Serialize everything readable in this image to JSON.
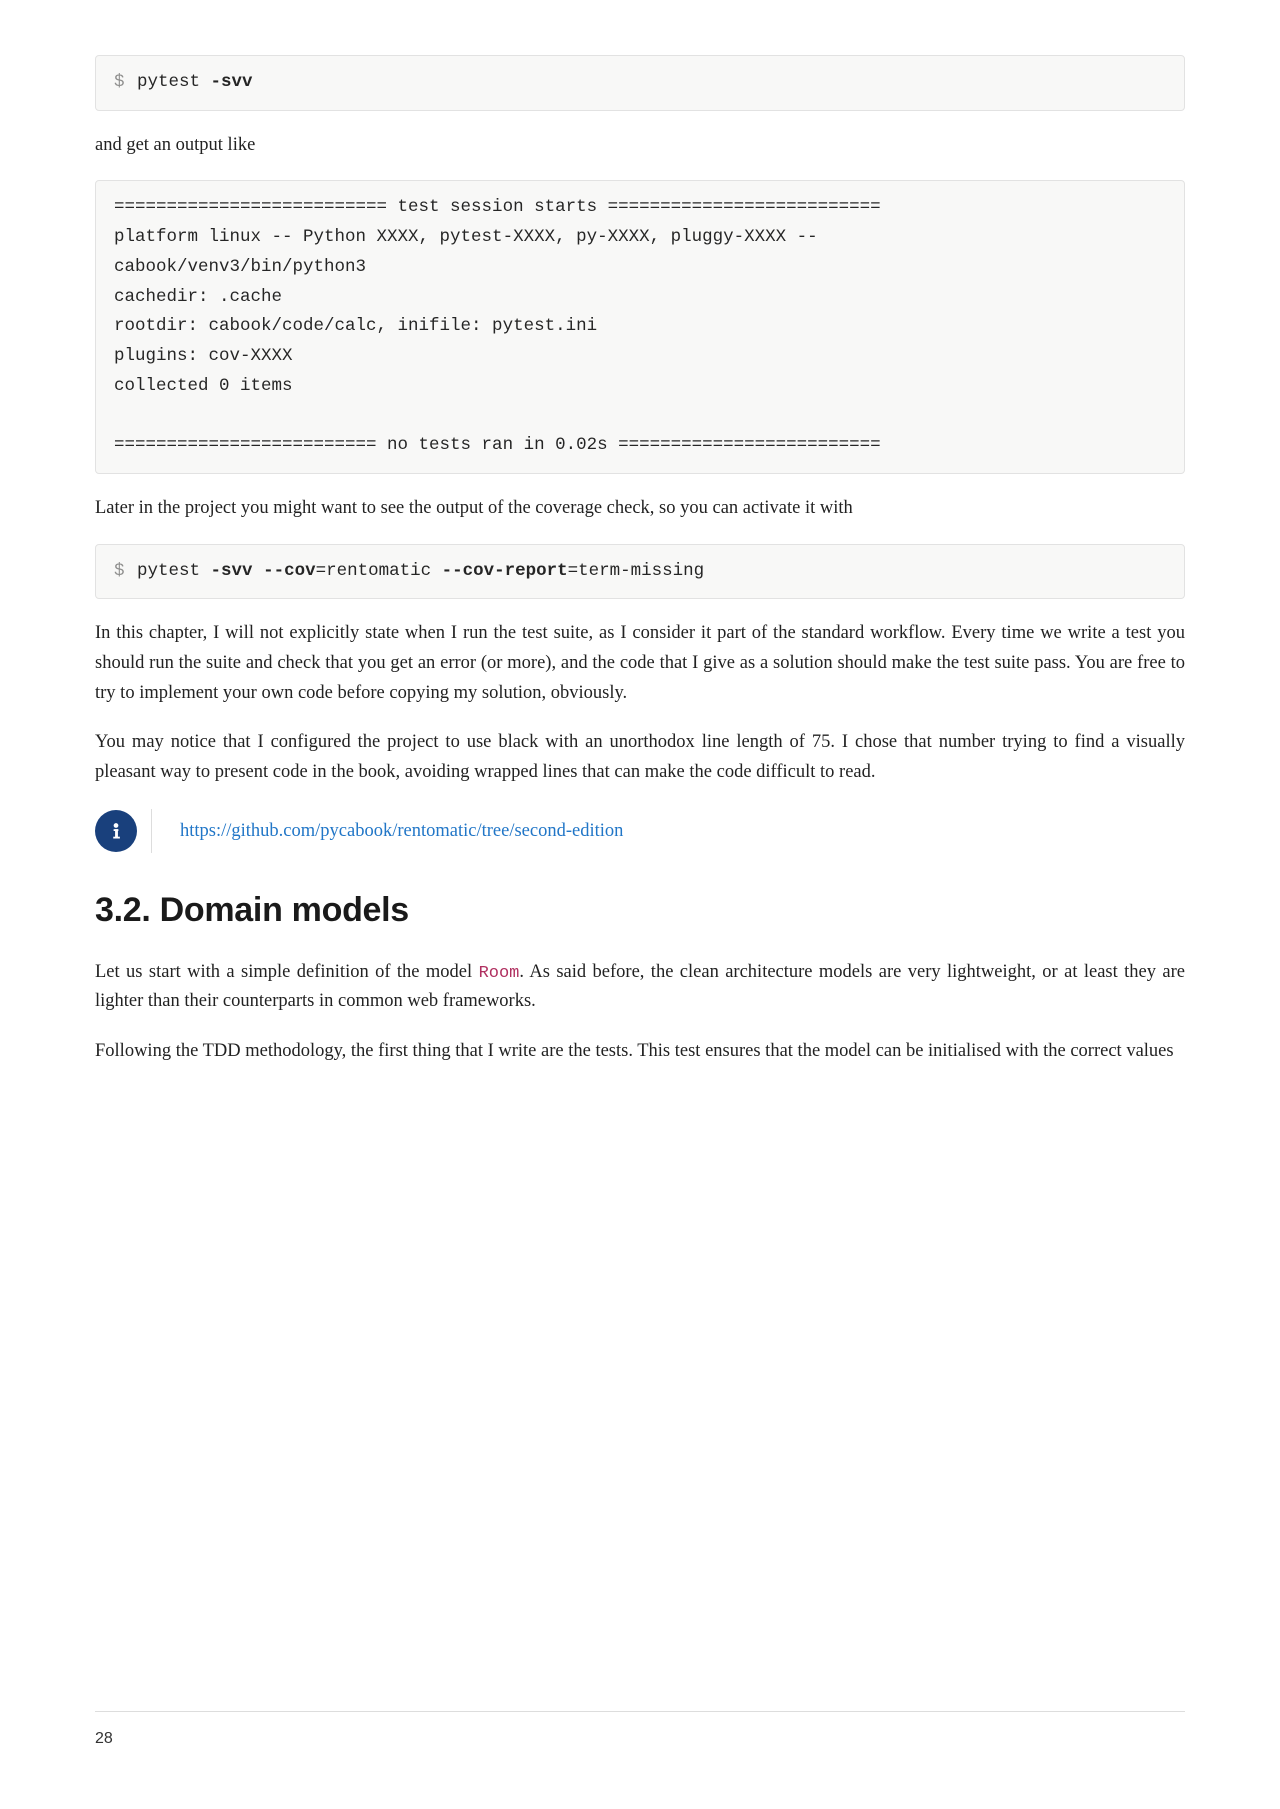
{
  "code1": {
    "prompt": "$",
    "cmd": " pytest ",
    "flag": "-svv"
  },
  "para1": "and get an output like",
  "code2": "========================== test session starts ==========================\nplatform linux -- Python XXXX, pytest-XXXX, py-XXXX, pluggy-XXXX --\ncabook/venv3/bin/python3\ncachedir: .cache\nrootdir: cabook/code/calc, inifile: pytest.ini\nplugins: cov-XXXX\ncollected 0 items\n\n========================= no tests ran in 0.02s =========================",
  "para2": "Later in the project you might want to see the output of the coverage check, so you can activate it with",
  "code3": {
    "prompt": "$",
    "cmd1": " pytest ",
    "flag1": "-svv",
    "sp1": " ",
    "flag2": "--cov",
    "val1": "=rentomatic ",
    "flag3": "--cov-report",
    "val2": "=term-missing"
  },
  "para3": "In this chapter, I will not explicitly state when I run the test suite, as I consider it part of the standard workflow. Every time we write a test you should run the suite and check that you get an error (or more), and the code that I give as a solution should make the test suite pass. You are free to try to implement your own code before copying my solution, obviously.",
  "para4": "You may notice that I configured the project to use black with an unorthodox line length of 75. I chose that number trying to find a visually pleasant way to present code in the book, avoiding wrapped lines that can make the code difficult to read.",
  "info_link": "https://github.com/pycabook/rentomatic/tree/second-edition",
  "section_heading": "3.2. Domain models",
  "para5_pre": "Let us start with a simple definition of the model ",
  "para5_code": "Room",
  "para5_post": ". As said before, the clean architecture models are very lightweight, or at least they are lighter than their counterparts in common web frameworks.",
  "para6": "Following the TDD methodology, the first thing that I write are the tests. This test ensures that the model can be initialised with the correct values",
  "page_number": "28"
}
